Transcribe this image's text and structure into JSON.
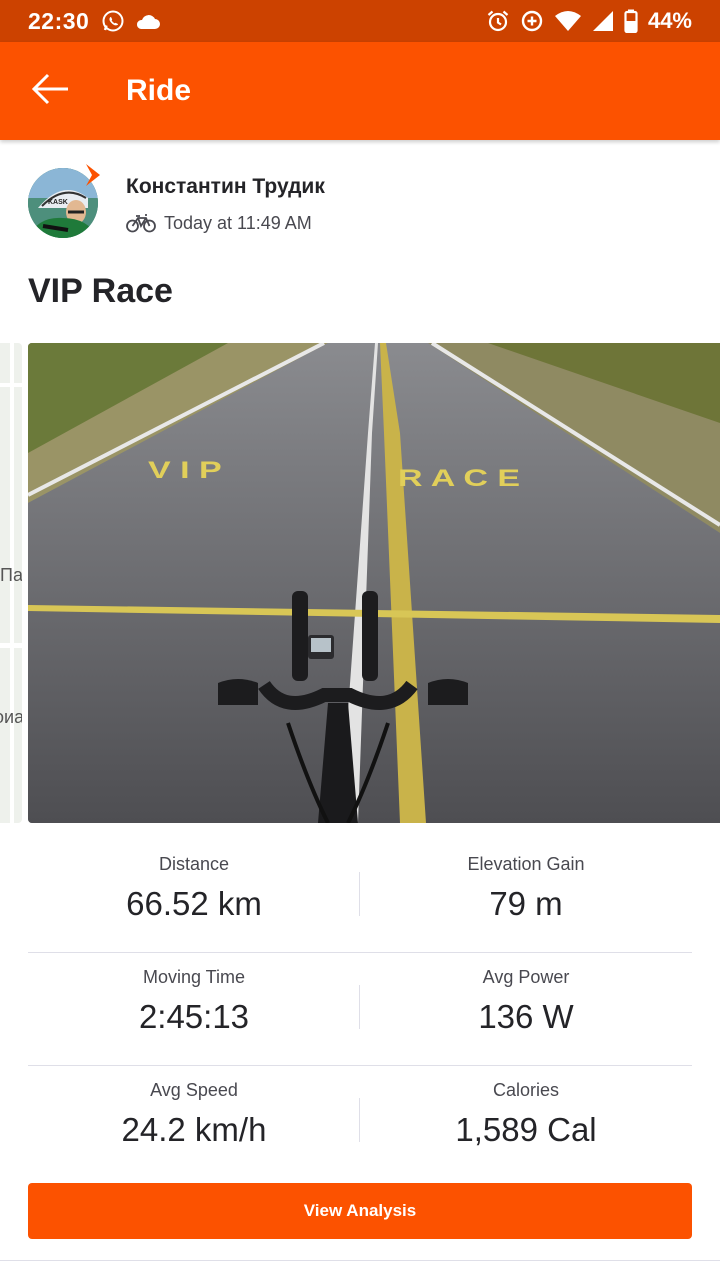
{
  "status_bar": {
    "time": "22:30",
    "battery_percent": "44%"
  },
  "app_bar": {
    "title": "Ride",
    "back_icon": "arrow-left-icon"
  },
  "athlete": {
    "name": "Константин Трудик",
    "timestamp": "Today at 11:49 AM",
    "activity_icon": "bike-icon"
  },
  "activity": {
    "title": "VIP Race"
  },
  "map_peek_labels": [
    "Па",
    "оиа"
  ],
  "stats": [
    [
      {
        "label": "Distance",
        "value": "66.52 km"
      },
      {
        "label": "Elevation Gain",
        "value": "79 m"
      }
    ],
    [
      {
        "label": "Moving Time",
        "value": "2:45:13"
      },
      {
        "label": "Avg Power",
        "value": "136 W"
      }
    ],
    [
      {
        "label": "Avg Speed",
        "value": "24.2 km/h"
      },
      {
        "label": "Calories",
        "value": "1,589 Cal"
      }
    ]
  ],
  "view_analysis_label": "View Analysis",
  "colors": {
    "brand": "#fc5200",
    "status_bar": "#cc4200"
  }
}
